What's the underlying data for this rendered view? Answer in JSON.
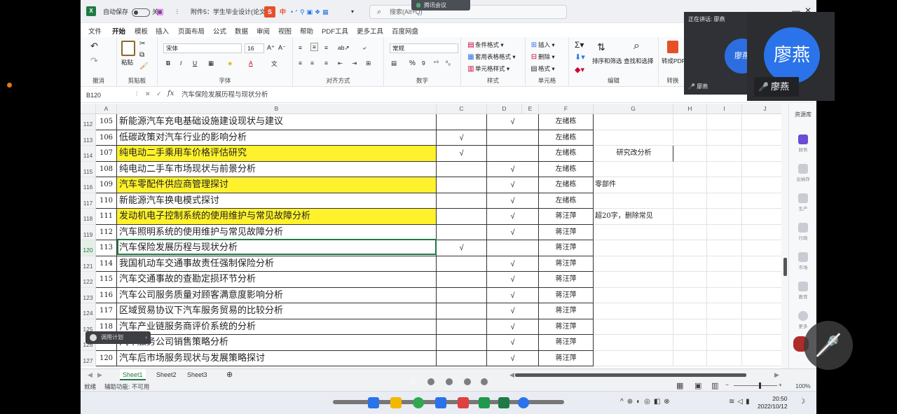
{
  "titlebar": {
    "autosave_label": "自动保存",
    "autosave_state": "关",
    "doc_title": "附件5：学生毕业设计(论文)",
    "search_placeholder": "搜索(Alt+Q)",
    "meeting_tag": "腾讯会议"
  },
  "menu": [
    "文件",
    "开始",
    "模板",
    "插入",
    "页面布局",
    "公式",
    "数据",
    "审阅",
    "视图",
    "帮助",
    "PDF工具",
    "更多工具",
    "百度网盘"
  ],
  "active_menu": "开始",
  "ribbon": {
    "undo": "撤消",
    "paste": "粘贴",
    "clipboard": "剪贴板",
    "font_name": "宋体",
    "font_size": "16",
    "font_group": "字体",
    "align_group": "对齐方式",
    "number_format": "常规",
    "number_group": "数字",
    "cond_format": "条件格式",
    "table_format": "套用表格格式",
    "cell_style": "单元格样式",
    "style_group": "样式",
    "insert": "插入",
    "delete": "删除",
    "format": "格式",
    "cells_group": "单元格",
    "sort_filter": "排序和筛选",
    "find_select": "查找和选择",
    "edit_group": "编辑",
    "to_pdf": "转成PDF",
    "convert_group": "转换"
  },
  "formula_bar": {
    "name_box": "B120",
    "fx": "fx",
    "content": "汽车保险发展历程与现状分析"
  },
  "columns": [
    "A",
    "B",
    "C",
    "D",
    "E",
    "F",
    "G",
    "H",
    "I",
    "J"
  ],
  "rows": [
    {
      "rn": "112",
      "a": "105",
      "b": "新能源汽车充电基础设施建设现状与建议",
      "c": "",
      "d": "√",
      "f": "左绪栋",
      "g": "",
      "hl": false
    },
    {
      "rn": "113",
      "a": "106",
      "b": "低碳政策对汽车行业的影响分析",
      "c": "√",
      "d": "",
      "f": "左绪栋",
      "g": "",
      "hl": false
    },
    {
      "rn": "114",
      "a": "107",
      "b": "纯电动二手乘用车价格评估研究",
      "c": "√",
      "d": "",
      "f": "左绪栋",
      "g": "研究改分析",
      "hl": true
    },
    {
      "rn": "115",
      "a": "108",
      "b": "纯电动二手车市场现状与前景分析",
      "c": "",
      "d": "√",
      "f": "左绪栋",
      "g": "",
      "hl": false
    },
    {
      "rn": "116",
      "a": "109",
      "b": "汽车零配件供应商管理探讨",
      "c": "",
      "d": "√",
      "f": "左绪栋",
      "g": "零部件",
      "hl": true
    },
    {
      "rn": "117",
      "a": "110",
      "b": "新能源汽车换电模式探讨",
      "c": "",
      "d": "√",
      "f": "左绪栋",
      "g": "",
      "hl": false
    },
    {
      "rn": "118",
      "a": "111",
      "b": "发动机电子控制系统的使用维护与常见故障分析",
      "c": "",
      "d": "√",
      "f": "蒋汪萍",
      "g": "超20字，删除常见",
      "hl": true
    },
    {
      "rn": "119",
      "a": "112",
      "b": "汽车照明系统的使用维护与常见故障分析",
      "c": "",
      "d": "√",
      "f": "蒋汪萍",
      "g": "",
      "hl": false
    },
    {
      "rn": "120",
      "a": "113",
      "b": "汽车保险发展历程与现状分析",
      "c": "√",
      "d": "",
      "f": "蒋汪萍",
      "g": "",
      "hl": false
    },
    {
      "rn": "121",
      "a": "114",
      "b": "我国机动车交通事故责任强制保险分析",
      "c": "",
      "d": "√",
      "f": "蒋汪萍",
      "g": "",
      "hl": false
    },
    {
      "rn": "122",
      "a": "115",
      "b": "汽车交通事故的查勘定损环节分析",
      "c": "",
      "d": "√",
      "f": "蒋汪萍",
      "g": "",
      "hl": false
    },
    {
      "rn": "123",
      "a": "116",
      "b": "汽车公司服务质量对顾客满意度影响分析",
      "c": "",
      "d": "√",
      "f": "蒋汪萍",
      "g": "",
      "hl": false
    },
    {
      "rn": "124",
      "a": "117",
      "b": "区域贸易协议下汽车服务贸易的比较分析",
      "c": "",
      "d": "√",
      "f": "蒋汪萍",
      "g": "",
      "hl": false
    },
    {
      "rn": "125",
      "a": "118",
      "b": "汽车产业链服务商评价系统的分析",
      "c": "",
      "d": "√",
      "f": "蒋汪萍",
      "g": "",
      "hl": false
    },
    {
      "rn": "126",
      "a": "119",
      "b": "汽车服务公司销售策略分析",
      "c": "",
      "d": "√",
      "f": "蒋汪萍",
      "g": "",
      "hl": false
    },
    {
      "rn": "127",
      "a": "120",
      "b": "汽车后市场服务现状与发展策略探讨",
      "c": "",
      "d": "√",
      "f": "蒋汪萍",
      "g": "",
      "hl": false
    }
  ],
  "fill_caption": "调用计划",
  "sheets": [
    "Sheet1",
    "Sheet2",
    "Sheet3"
  ],
  "status": {
    "ready": "就绪",
    "accessibility": "辅助功能: 不可用",
    "zoom": "100%"
  },
  "right_pane": {
    "title": "资源库",
    "items": [
      "财务",
      "出纳存",
      "生产",
      "行政",
      "市场",
      "教育",
      "更多"
    ]
  },
  "clock": {
    "time": "20:50",
    "date": "2022/10/12"
  },
  "meeting": {
    "speaking": "正在讲话: 廖燕",
    "small_name": "廖燕",
    "avatar_text": "廖燕",
    "name": "廖燕"
  },
  "colors": {
    "accent": "#1f7a45",
    "highlight": "#fff22c",
    "meeting_blue": "#2a73ea"
  }
}
